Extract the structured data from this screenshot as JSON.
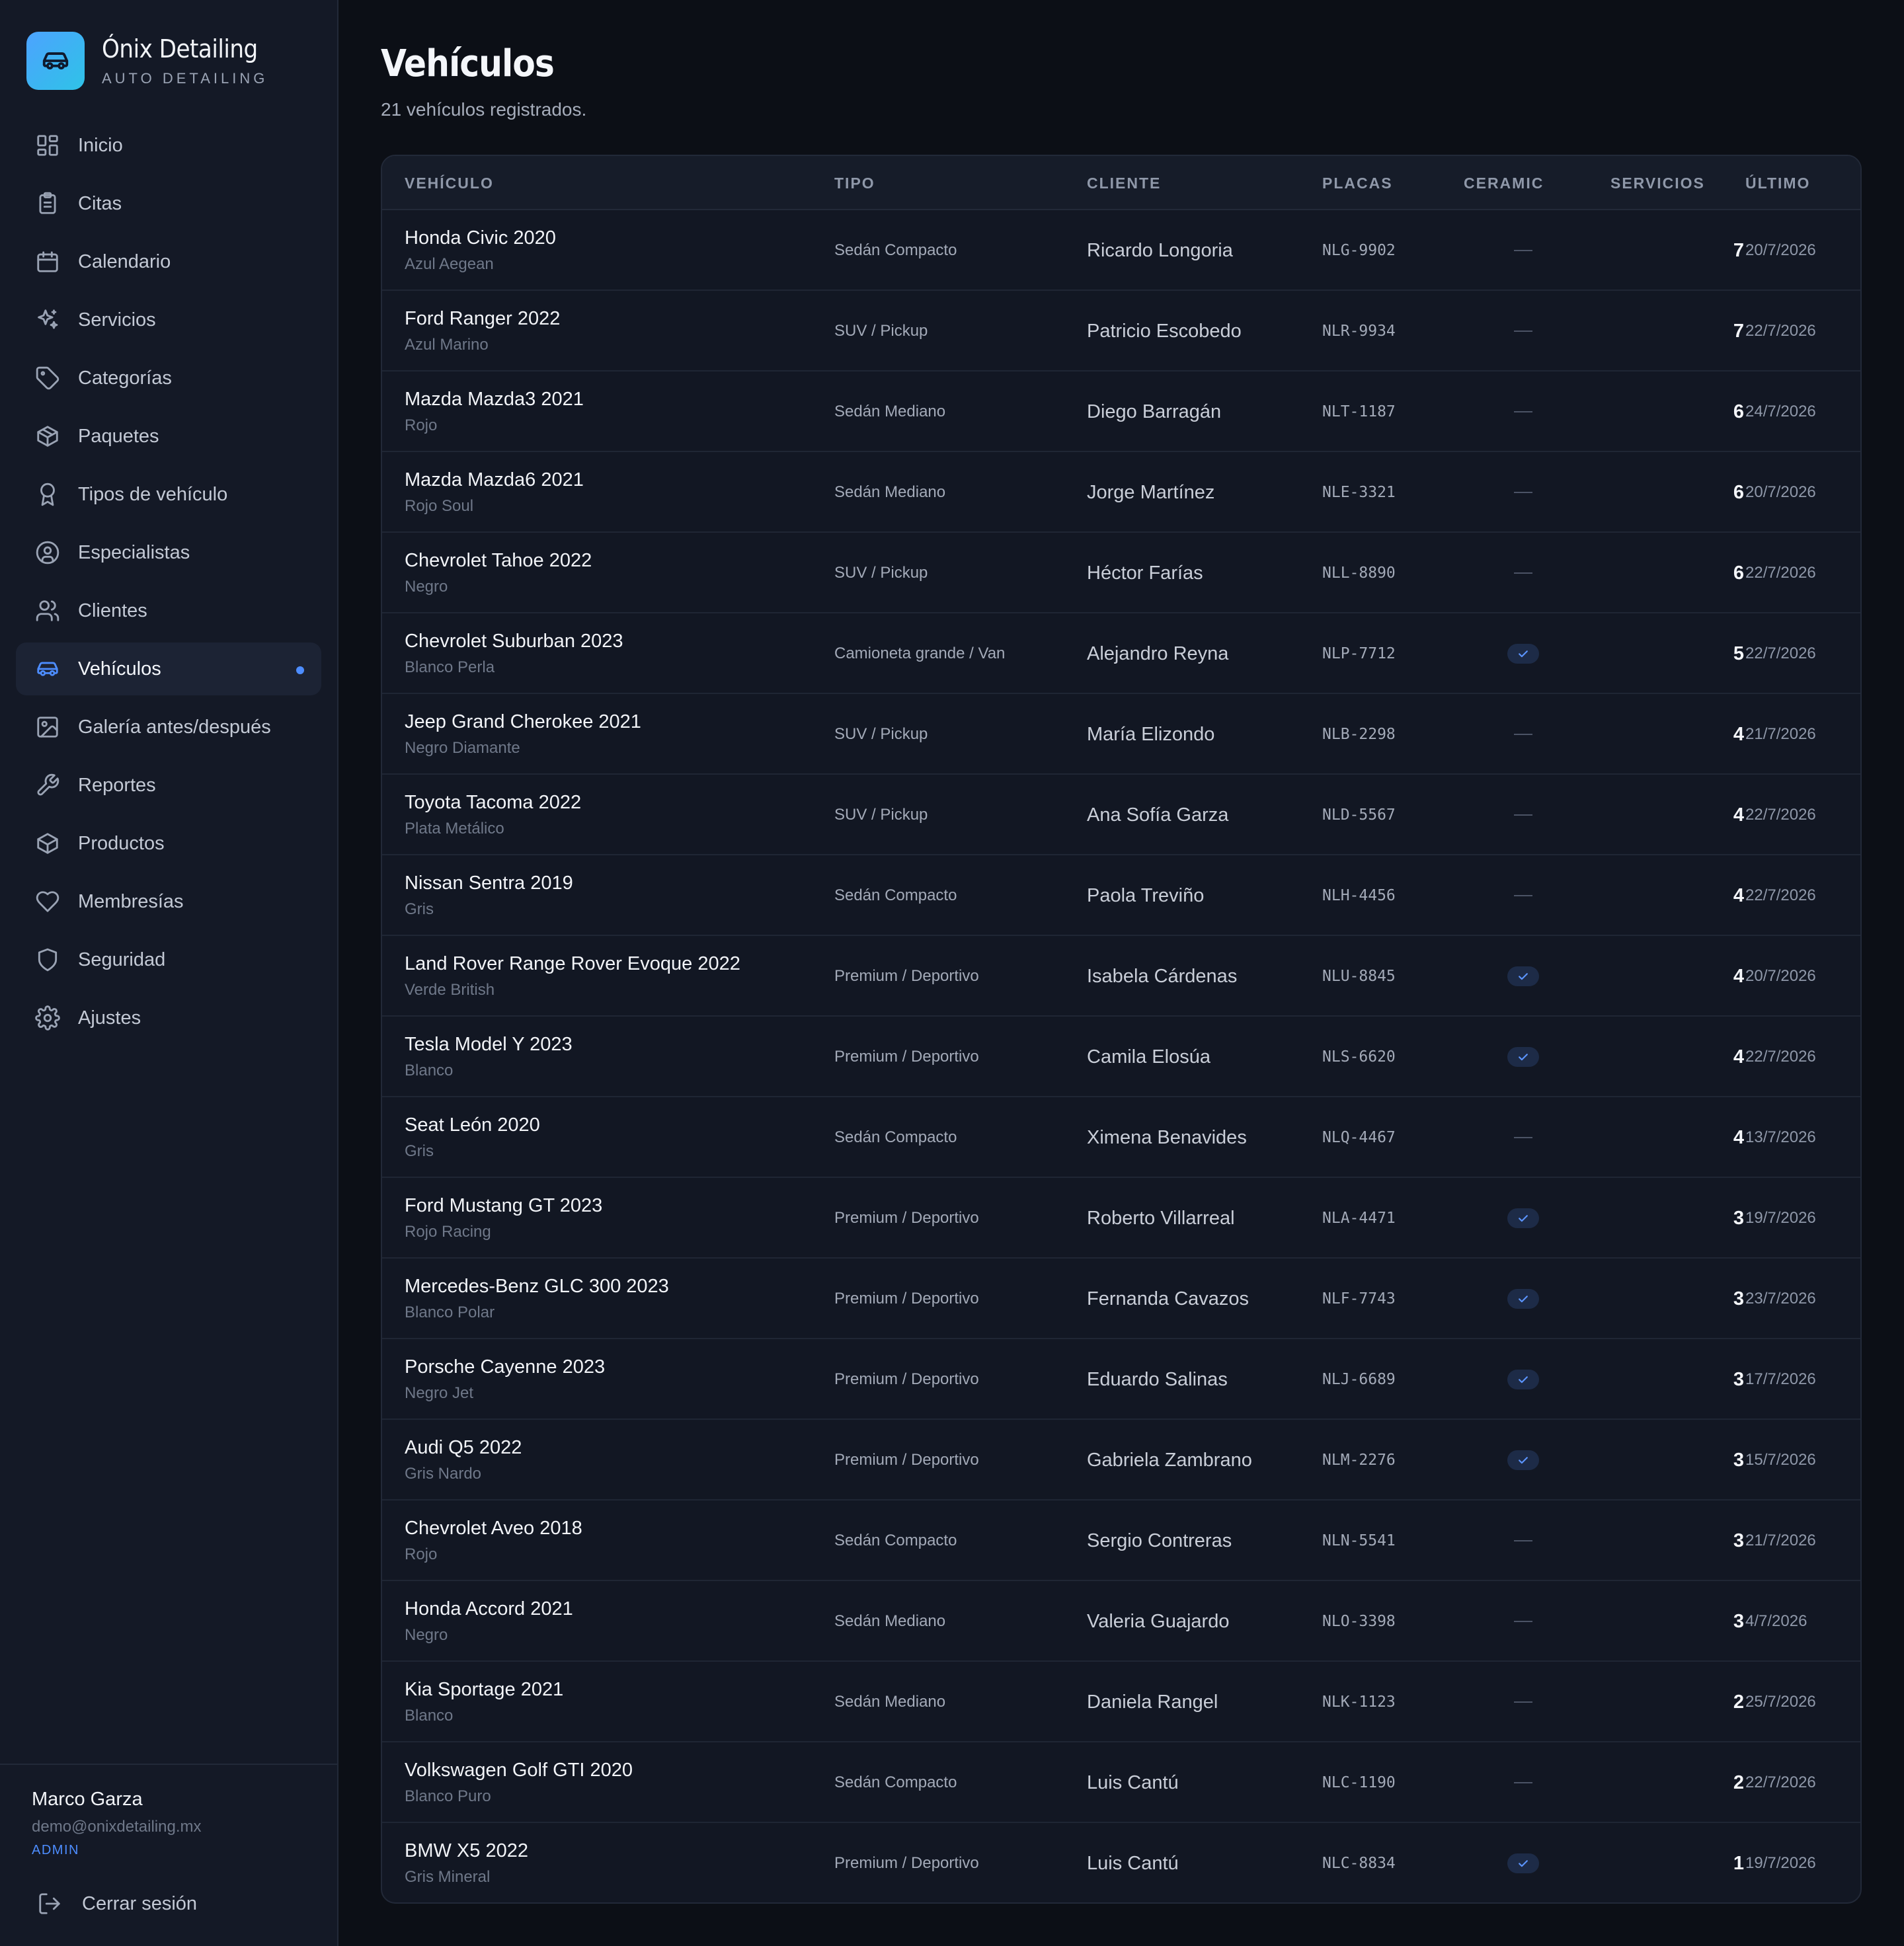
{
  "brand": {
    "name": "Ónix Detailing",
    "subtitle": "AUTO DETAILING"
  },
  "nav": [
    {
      "label": "Inicio",
      "icon": "dashboard-grid-icon"
    },
    {
      "label": "Citas",
      "icon": "clipboard-icon"
    },
    {
      "label": "Calendario",
      "icon": "calendar-icon"
    },
    {
      "label": "Servicios",
      "icon": "sparkles-icon"
    },
    {
      "label": "Categorías",
      "icon": "tag-icon"
    },
    {
      "label": "Paquetes",
      "icon": "package-icon"
    },
    {
      "label": "Tipos de vehículo",
      "icon": "award-icon"
    },
    {
      "label": "Especialistas",
      "icon": "user-circle-icon"
    },
    {
      "label": "Clientes",
      "icon": "users-icon"
    },
    {
      "label": "Vehículos",
      "icon": "car-icon",
      "active": true
    },
    {
      "label": "Galería antes/después",
      "icon": "image-icon"
    },
    {
      "label": "Reportes",
      "icon": "wrench-icon"
    },
    {
      "label": "Productos",
      "icon": "box-icon"
    },
    {
      "label": "Membresías",
      "icon": "heart-icon"
    },
    {
      "label": "Seguridad",
      "icon": "shield-icon"
    },
    {
      "label": "Ajustes",
      "icon": "gear-icon"
    }
  ],
  "user": {
    "name": "Marco Garza",
    "email": "demo@onixdetailing.mx",
    "role": "ADMIN",
    "logout_label": "Cerrar sesión"
  },
  "page": {
    "title": "Vehículos",
    "subtitle": "21 vehículos registrados."
  },
  "table": {
    "headers": {
      "vehiculo": "VEHÍCULO",
      "tipo": "TIPO",
      "cliente": "CLIENTE",
      "placas": "PLACAS",
      "ceramic": "CERAMIC",
      "servicios": "SERVICIOS",
      "ultimo": "ÚLTIMO"
    },
    "rows": [
      {
        "vehiculo": "Honda Civic 2020",
        "color": "Azul Aegean",
        "tipo": "Sedán Compacto",
        "cliente": "Ricardo Longoria",
        "placas": "NLG-9902",
        "ceramic": false,
        "servicios": "7",
        "ultimo": "20/7/2026"
      },
      {
        "vehiculo": "Ford Ranger 2022",
        "color": "Azul Marino",
        "tipo": "SUV / Pickup",
        "cliente": "Patricio Escobedo",
        "placas": "NLR-9934",
        "ceramic": false,
        "servicios": "7",
        "ultimo": "22/7/2026"
      },
      {
        "vehiculo": "Mazda Mazda3 2021",
        "color": "Rojo",
        "tipo": "Sedán Mediano",
        "cliente": "Diego Barragán",
        "placas": "NLT-1187",
        "ceramic": false,
        "servicios": "6",
        "ultimo": "24/7/2026"
      },
      {
        "vehiculo": "Mazda Mazda6 2021",
        "color": "Rojo Soul",
        "tipo": "Sedán Mediano",
        "cliente": "Jorge Martínez",
        "placas": "NLE-3321",
        "ceramic": false,
        "servicios": "6",
        "ultimo": "20/7/2026"
      },
      {
        "vehiculo": "Chevrolet Tahoe 2022",
        "color": "Negro",
        "tipo": "SUV / Pickup",
        "cliente": "Héctor Farías",
        "placas": "NLL-8890",
        "ceramic": false,
        "servicios": "6",
        "ultimo": "22/7/2026"
      },
      {
        "vehiculo": "Chevrolet Suburban 2023",
        "color": "Blanco Perla",
        "tipo": "Camioneta grande / Van",
        "cliente": "Alejandro Reyna",
        "placas": "NLP-7712",
        "ceramic": true,
        "servicios": "5",
        "ultimo": "22/7/2026"
      },
      {
        "vehiculo": "Jeep Grand Cherokee 2021",
        "color": "Negro Diamante",
        "tipo": "SUV / Pickup",
        "cliente": "María Elizondo",
        "placas": "NLB-2298",
        "ceramic": false,
        "servicios": "4",
        "ultimo": "21/7/2026"
      },
      {
        "vehiculo": "Toyota Tacoma 2022",
        "color": "Plata Metálico",
        "tipo": "SUV / Pickup",
        "cliente": "Ana Sofía Garza",
        "placas": "NLD-5567",
        "ceramic": false,
        "servicios": "4",
        "ultimo": "22/7/2026"
      },
      {
        "vehiculo": "Nissan Sentra 2019",
        "color": "Gris",
        "tipo": "Sedán Compacto",
        "cliente": "Paola Treviño",
        "placas": "NLH-4456",
        "ceramic": false,
        "servicios": "4",
        "ultimo": "22/7/2026"
      },
      {
        "vehiculo": "Land Rover Range Rover Evoque 2022",
        "color": "Verde British",
        "tipo": "Premium / Deportivo",
        "cliente": "Isabela Cárdenas",
        "placas": "NLU-8845",
        "ceramic": true,
        "servicios": "4",
        "ultimo": "20/7/2026"
      },
      {
        "vehiculo": "Tesla Model Y 2023",
        "color": "Blanco",
        "tipo": "Premium / Deportivo",
        "cliente": "Camila Elosúa",
        "placas": "NLS-6620",
        "ceramic": true,
        "servicios": "4",
        "ultimo": "22/7/2026"
      },
      {
        "vehiculo": "Seat León 2020",
        "color": "Gris",
        "tipo": "Sedán Compacto",
        "cliente": "Ximena Benavides",
        "placas": "NLQ-4467",
        "ceramic": false,
        "servicios": "4",
        "ultimo": "13/7/2026"
      },
      {
        "vehiculo": "Ford Mustang GT 2023",
        "color": "Rojo Racing",
        "tipo": "Premium / Deportivo",
        "cliente": "Roberto Villarreal",
        "placas": "NLA-4471",
        "ceramic": true,
        "servicios": "3",
        "ultimo": "19/7/2026"
      },
      {
        "vehiculo": "Mercedes-Benz GLC 300 2023",
        "color": "Blanco Polar",
        "tipo": "Premium / Deportivo",
        "cliente": "Fernanda Cavazos",
        "placas": "NLF-7743",
        "ceramic": true,
        "servicios": "3",
        "ultimo": "23/7/2026"
      },
      {
        "vehiculo": "Porsche Cayenne 2023",
        "color": "Negro Jet",
        "tipo": "Premium / Deportivo",
        "cliente": "Eduardo Salinas",
        "placas": "NLJ-6689",
        "ceramic": true,
        "servicios": "3",
        "ultimo": "17/7/2026"
      },
      {
        "vehiculo": "Audi Q5 2022",
        "color": "Gris Nardo",
        "tipo": "Premium / Deportivo",
        "cliente": "Gabriela Zambrano",
        "placas": "NLM-2276",
        "ceramic": true,
        "servicios": "3",
        "ultimo": "15/7/2026"
      },
      {
        "vehiculo": "Chevrolet Aveo 2018",
        "color": "Rojo",
        "tipo": "Sedán Compacto",
        "cliente": "Sergio Contreras",
        "placas": "NLN-5541",
        "ceramic": false,
        "servicios": "3",
        "ultimo": "21/7/2026"
      },
      {
        "vehiculo": "Honda Accord 2021",
        "color": "Negro",
        "tipo": "Sedán Mediano",
        "cliente": "Valeria Guajardo",
        "placas": "NLO-3398",
        "ceramic": false,
        "servicios": "3",
        "ultimo": "4/7/2026"
      },
      {
        "vehiculo": "Kia Sportage 2021",
        "color": "Blanco",
        "tipo": "Sedán Mediano",
        "cliente": "Daniela Rangel",
        "placas": "NLK-1123",
        "ceramic": false,
        "servicios": "2",
        "ultimo": "25/7/2026"
      },
      {
        "vehiculo": "Volkswagen Golf GTI 2020",
        "color": "Blanco Puro",
        "tipo": "Sedán Compacto",
        "cliente": "Luis Cantú",
        "placas": "NLC-1190",
        "ceramic": false,
        "servicios": "2",
        "ultimo": "22/7/2026"
      },
      {
        "vehiculo": "BMW X5 2022",
        "color": "Gris Mineral",
        "tipo": "Premium / Deportivo",
        "cliente": "Luis Cantú",
        "placas": "NLC-8834",
        "ceramic": true,
        "servicios": "1",
        "ultimo": "19/7/2026"
      }
    ]
  },
  "colors": {
    "accent": "#4d8dff",
    "background": "#0c0f16",
    "sidebar": "#141926"
  }
}
